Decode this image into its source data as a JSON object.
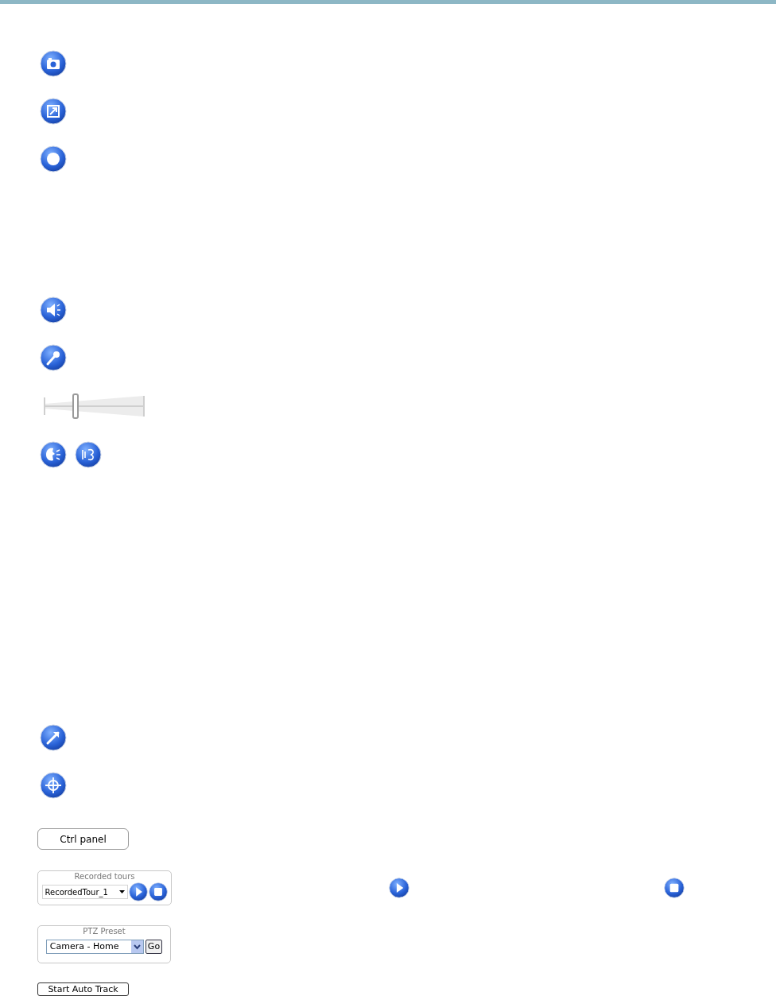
{
  "volume_slider": {
    "level": 0.3
  },
  "ctrl_panel_button": {
    "label": "Ctrl panel"
  },
  "recorded_tours": {
    "title": "Recorded tours",
    "value": "RecordedTour_1"
  },
  "ptz_preset": {
    "title": "PTZ Preset",
    "value": "Camera - Home",
    "button": "Go"
  },
  "auto_track_button": {
    "label": "Start Auto Track"
  }
}
